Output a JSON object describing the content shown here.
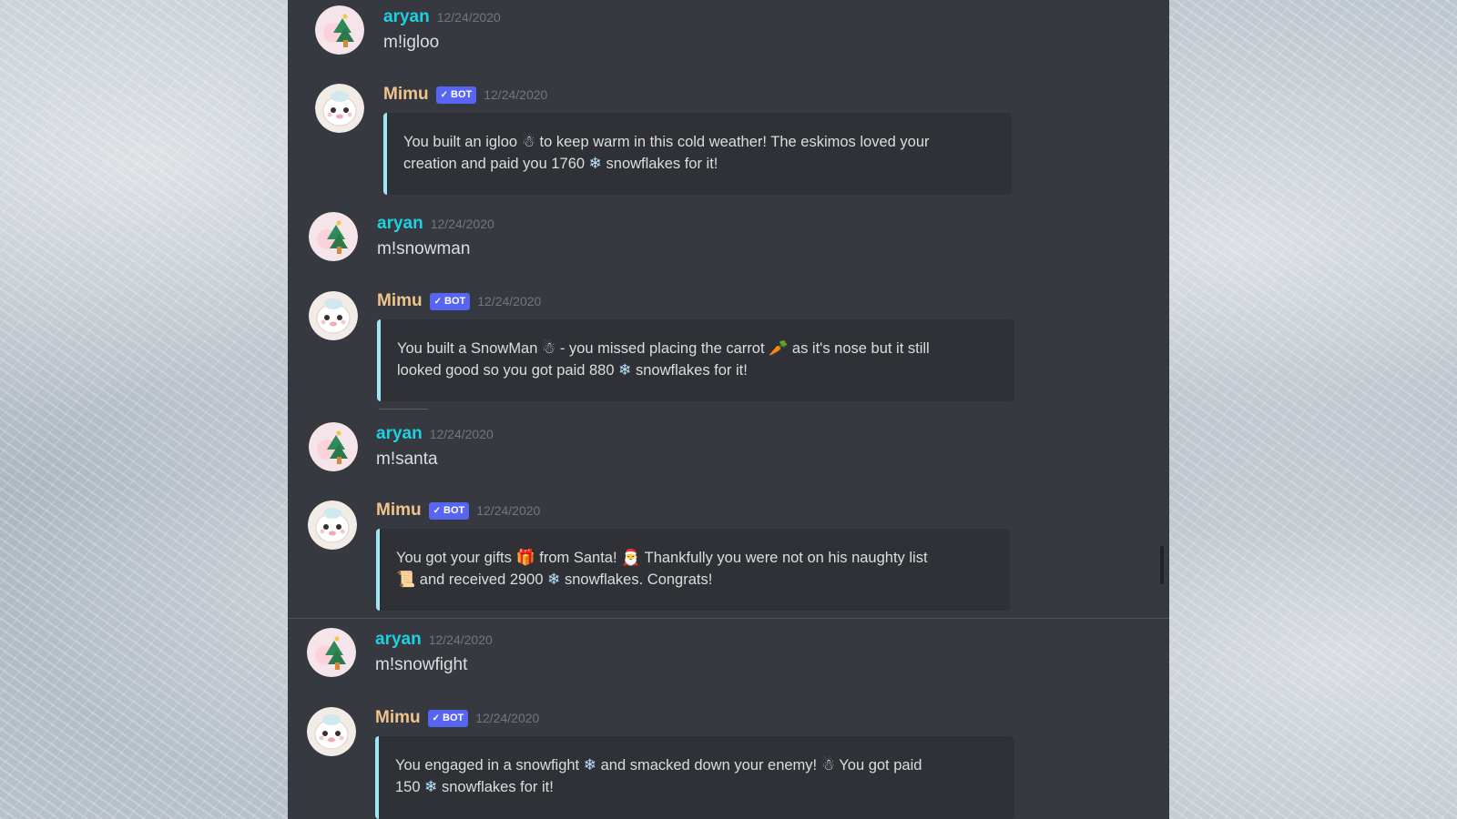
{
  "messages": [
    {
      "author": "aryan",
      "timestamp": "12/24/2020",
      "text": "m!igloo"
    },
    {
      "author": "Mimu",
      "bot_tag": "BOT",
      "timestamp": "12/24/2020",
      "embed": {
        "part1": "You built an igloo",
        "part2": "to keep warm in this cold weather! The eskimos loved your",
        "part3": "creation and paid you 1760",
        "part4": "snowflakes for it!"
      }
    },
    {
      "author": "aryan",
      "timestamp": "12/24/2020",
      "text": "m!snowman"
    },
    {
      "author": "Mimu",
      "bot_tag": "BOT",
      "timestamp": "12/24/2020",
      "embed": {
        "part1": "You built a SnowMan",
        "part2": "- you missed placing the carrot",
        "part3": "as it's nose but it still",
        "part4": "looked good so you got paid 880",
        "part5": "snowflakes for it!"
      }
    },
    {
      "author": "aryan",
      "timestamp": "12/24/2020",
      "text": "m!santa"
    },
    {
      "author": "Mimu",
      "bot_tag": "BOT",
      "timestamp": "12/24/2020",
      "embed": {
        "part1": "You got your gifts",
        "part2": "from Santa!",
        "part3": "Thankfully you were not on his naughty list",
        "part4": "and received 2900",
        "part5": "snowflakes. Congrats!"
      }
    },
    {
      "author": "aryan",
      "timestamp": "12/24/2020",
      "text": "m!snowfight"
    },
    {
      "author": "Mimu",
      "bot_tag": "BOT",
      "timestamp": "12/24/2020",
      "embed": {
        "part1": "You engaged in a snowfight",
        "part2": "and smacked down your enemy!",
        "part3": "You got paid",
        "part4": "150",
        "part5": "snowflakes for it!"
      }
    }
  ],
  "icons": {
    "check": "✓",
    "snowflake": "❄",
    "snowman": "☃",
    "gift": "🎁",
    "santa": "🎅",
    "scroll": "📜",
    "carrot": "🥕",
    "snowball": "☃"
  },
  "colors": {
    "user_name": "#1ed1e0",
    "bot_name": "#f0c48a",
    "bot_tag": "#5865f2",
    "embed_border": "#9fe7f5",
    "panel": "#36393f",
    "embed_bg": "#2f3136"
  }
}
